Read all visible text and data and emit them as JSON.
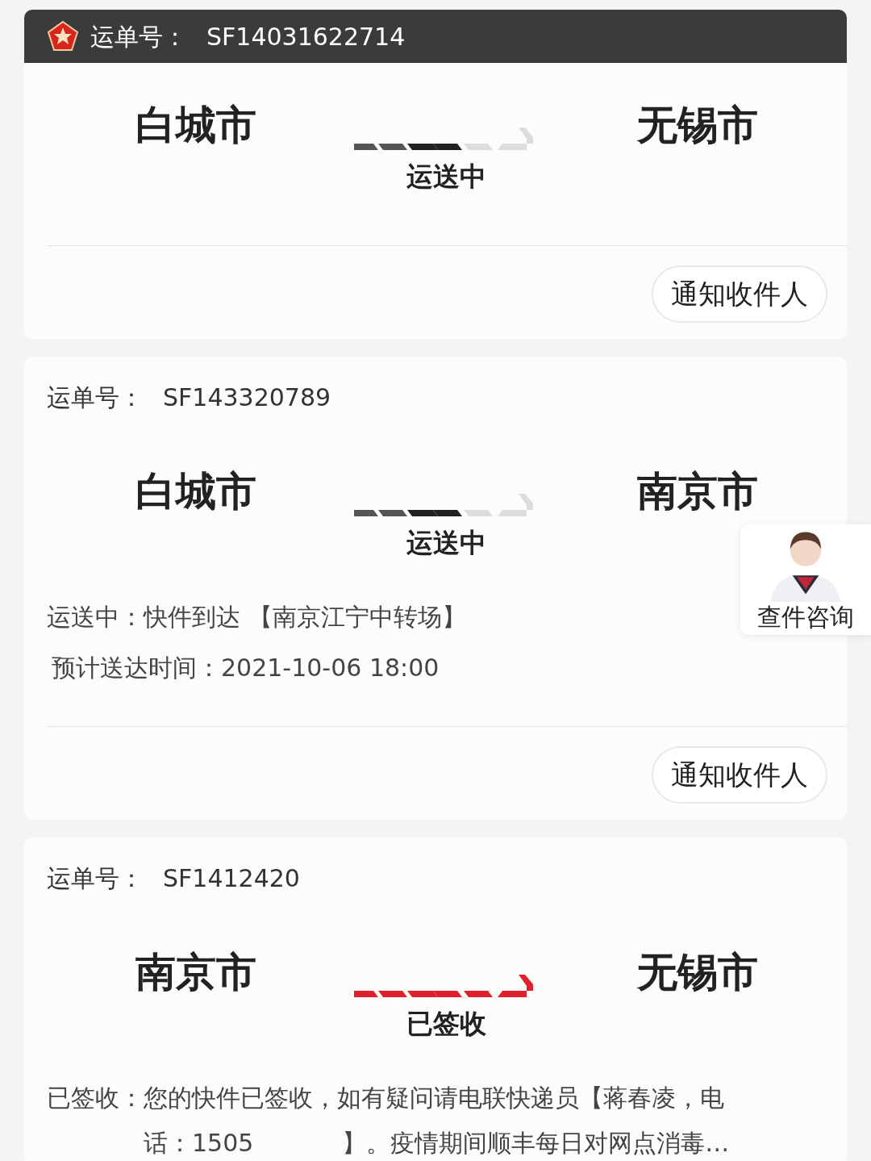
{
  "shipments": [
    {
      "highlighted": true,
      "label": "运单号：",
      "tracking_no": "SF14031622714",
      "origin": "白城市",
      "destination": "无锡市",
      "status": "运送中",
      "kind": "transit",
      "button": "通知收件人"
    },
    {
      "highlighted": false,
      "label": "运单号：",
      "tracking_no": "SF143320789",
      "origin": "白城市",
      "destination": "南京市",
      "status": "运送中",
      "kind": "transit",
      "details": [
        {
          "label": "运送中：",
          "parts": [
            "快件到达 【南京江宁中转场】"
          ]
        }
      ],
      "eta": "预计送达时间：2021-10-06 18:00",
      "button": "通知收件人"
    },
    {
      "highlighted": false,
      "label": "运单号：",
      "tracking_no": "SF1412420",
      "origin": "南京市",
      "destination": "无锡市",
      "status": "已签收",
      "kind": "signed",
      "details": [
        {
          "label": "已签收：",
          "parts": [
            "您的快件已签收，如有疑问请电联快递员【蒋春凌，电",
            "话：1505",
            "】。疫情期间顺丰每日对网点消毒…"
          ]
        }
      ]
    }
  ],
  "float_widget": {
    "label": "查件咨询"
  }
}
